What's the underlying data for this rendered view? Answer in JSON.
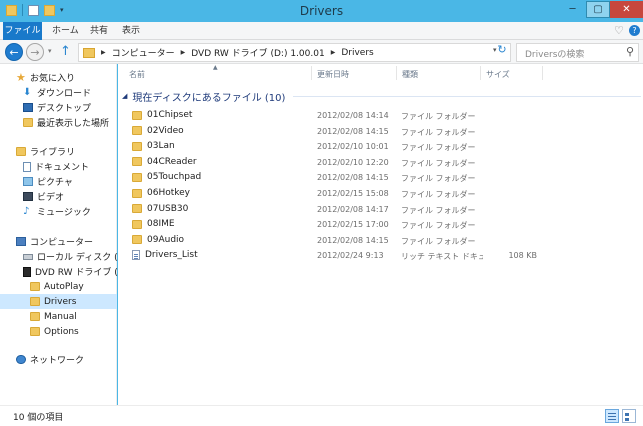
{
  "window": {
    "title": "Drivers"
  },
  "ribbon": {
    "file": "ファイル",
    "home": "ホーム",
    "share": "共有",
    "view": "表示"
  },
  "address": {
    "crumbs": [
      "コンピューター",
      "DVD RW ドライブ (D:) 1.00.01",
      "Drivers"
    ]
  },
  "search": {
    "placeholder": "Driversの検索"
  },
  "nav": {
    "favorites": "お気に入り",
    "downloads": "ダウンロード",
    "desktop": "デスクトップ",
    "recent": "最近表示した場所",
    "libraries": "ライブラリ",
    "documents": "ドキュメント",
    "pictures": "ピクチャ",
    "videos": "ビデオ",
    "music": "ミュージック",
    "computer": "コンピューター",
    "local_disk": "ローカル ディスク (C:)",
    "dvd": "DVD RW ドライブ (D:",
    "autoplay": "AutoPlay",
    "drivers": "Drivers",
    "manual": "Manual",
    "options": "Options",
    "network": "ネットワーク"
  },
  "columns": {
    "name": "名前",
    "date": "更新日時",
    "type": "種類",
    "size": "サイズ"
  },
  "group": {
    "title": "現在ディスクにあるファイル (10)"
  },
  "files": [
    {
      "name": "01Chipset",
      "date": "2012/02/08 14:14",
      "type": "ファイル フォルダー",
      "size": "",
      "kind": "folder"
    },
    {
      "name": "02Video",
      "date": "2012/02/08 14:15",
      "type": "ファイル フォルダー",
      "size": "",
      "kind": "folder"
    },
    {
      "name": "03Lan",
      "date": "2012/02/10 10:01",
      "type": "ファイル フォルダー",
      "size": "",
      "kind": "folder"
    },
    {
      "name": "04CReader",
      "date": "2012/02/10 12:20",
      "type": "ファイル フォルダー",
      "size": "",
      "kind": "folder"
    },
    {
      "name": "05Touchpad",
      "date": "2012/02/08 14:15",
      "type": "ファイル フォルダー",
      "size": "",
      "kind": "folder"
    },
    {
      "name": "06Hotkey",
      "date": "2012/02/15 15:08",
      "type": "ファイル フォルダー",
      "size": "",
      "kind": "folder"
    },
    {
      "name": "07USB30",
      "date": "2012/02/08 14:17",
      "type": "ファイル フォルダー",
      "size": "",
      "kind": "folder"
    },
    {
      "name": "08IME",
      "date": "2012/02/15 17:00",
      "type": "ファイル フォルダー",
      "size": "",
      "kind": "folder"
    },
    {
      "name": "09Audio",
      "date": "2012/02/08 14:15",
      "type": "ファイル フォルダー",
      "size": "",
      "kind": "folder"
    },
    {
      "name": "Drivers_List",
      "date": "2012/02/24 9:13",
      "type": "リッチ テキスト ドキュ...",
      "size": "108 KB",
      "kind": "document"
    }
  ],
  "status": {
    "count": "10 個の項目"
  },
  "colors": {
    "accent": "#1979ca",
    "titlebar": "#4ab7e6",
    "close": "#c7473d",
    "selection": "#cde8ff",
    "folder": "#f0c75e"
  }
}
